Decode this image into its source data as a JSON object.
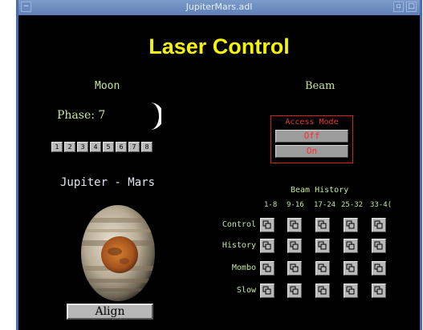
{
  "window": {
    "title": "JupiterMars.adl",
    "menu_button": "−",
    "min_button": "▫",
    "max_button": "□"
  },
  "main_title": "Laser Control",
  "moon": {
    "header": "Moon",
    "phase_label": "Phase: 7",
    "phase_buttons": [
      "1",
      "2",
      "3",
      "4",
      "5",
      "6",
      "7",
      "8"
    ]
  },
  "jupiter_mars": {
    "header": "Jupiter - Mars",
    "align_label": "Align"
  },
  "beam": {
    "header": "Beam",
    "access_mode": {
      "title": "Access Mode",
      "off_label": "Off",
      "on_label": "On"
    },
    "history": {
      "header": "Beam History",
      "columns": [
        "1-8",
        "9-16",
        "17-24",
        "25-32",
        "33-4("
      ],
      "rows": [
        "Control",
        "History",
        "Mombo",
        "Slow"
      ]
    }
  },
  "colors": {
    "background": "#000000",
    "title_yellow": "#f5f500",
    "label_green": "#c7e79f",
    "access_red": "#e01c1c",
    "button_gray": "#b9b9b9"
  }
}
